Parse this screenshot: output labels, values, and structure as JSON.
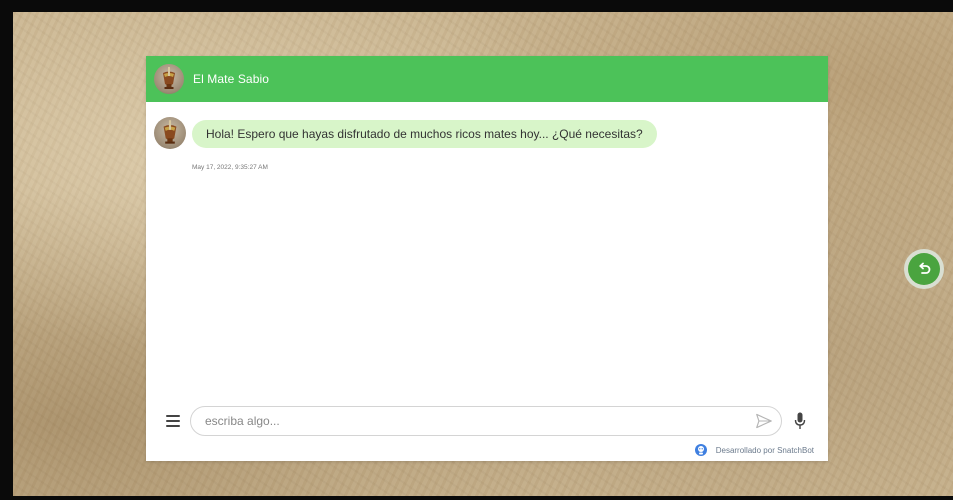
{
  "colors": {
    "header_bg": "#4cc259",
    "bubble_bg": "#d8f5c9",
    "back_button": "#4aa43f"
  },
  "header": {
    "title": "El Mate Sabio",
    "avatar_icon": "mate-cup-avatar"
  },
  "messages": [
    {
      "sender": "bot",
      "text": "Hola! Espero que hayas disfrutado de muchos ricos mates hoy... ¿Qué necesitas?",
      "timestamp": "May 17, 2022, 9:35:27 AM"
    }
  ],
  "composer": {
    "menu_icon": "menu-icon",
    "placeholder": "escriba algo...",
    "value": "",
    "send_icon": "send-icon",
    "mic_icon": "microphone-icon"
  },
  "footer": {
    "powered_by": "Desarrollado por SnatchBot"
  },
  "floating": {
    "back_icon": "undo-arrow-icon"
  }
}
